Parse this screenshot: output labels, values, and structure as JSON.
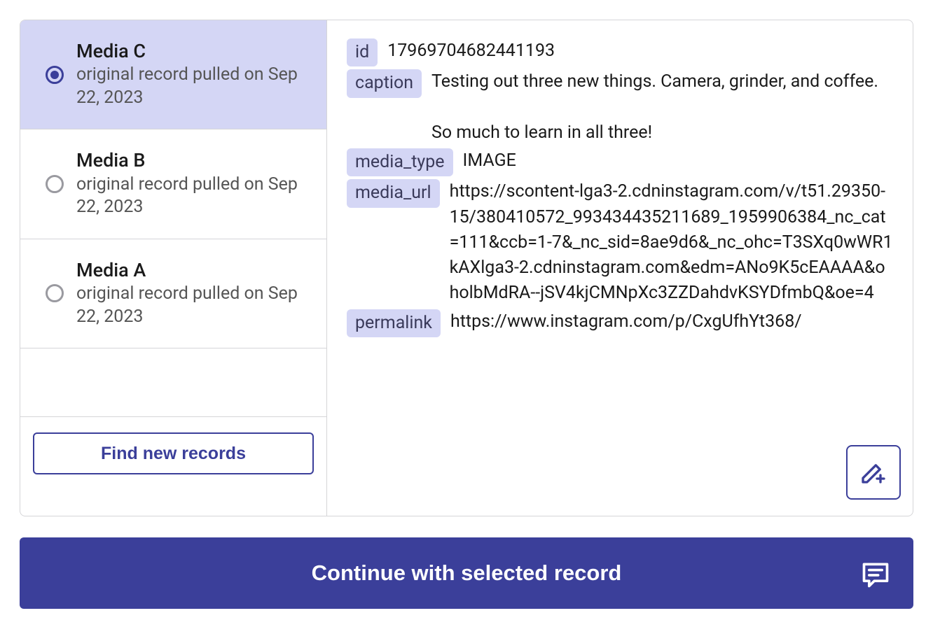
{
  "sidebar": {
    "records": [
      {
        "title": "Media C",
        "sub": "original record pulled on Sep 22, 2023",
        "selected": true
      },
      {
        "title": "Media B",
        "sub": "original record pulled on Sep 22, 2023",
        "selected": false
      },
      {
        "title": "Media A",
        "sub": "original record pulled on Sep 22, 2023",
        "selected": false
      }
    ],
    "find_label": "Find new records"
  },
  "detail": {
    "fields": {
      "id": {
        "key": "id",
        "value": "17969704682441193"
      },
      "caption": {
        "key": "caption",
        "value": "Testing out three new things. Camera, grinder, and coffee.\n\nSo much to learn in all three!"
      },
      "media_type": {
        "key": "media_type",
        "value": "IMAGE"
      },
      "media_url": {
        "key": "media_url",
        "value": "https://scontent-lga3-2.cdninstagram.com/v/t51.29350-15/380410572_993434435211689_1959906384_nc_cat=111&ccb=1-7&_nc_sid=8ae9d6&_nc_ohc=T3SXq0wWR1kAXlga3-2.cdninstagram.com&edm=ANo9K5cEAAAA&oholbMdRA--jSV4kjCMNpXc3ZZDahdvKSYDfmbQ&oe=4"
      },
      "permalink": {
        "key": "permalink",
        "value": "https://www.instagram.com/p/CxgUfhYt368/"
      }
    }
  },
  "footer": {
    "continue_label": "Continue with selected record"
  }
}
